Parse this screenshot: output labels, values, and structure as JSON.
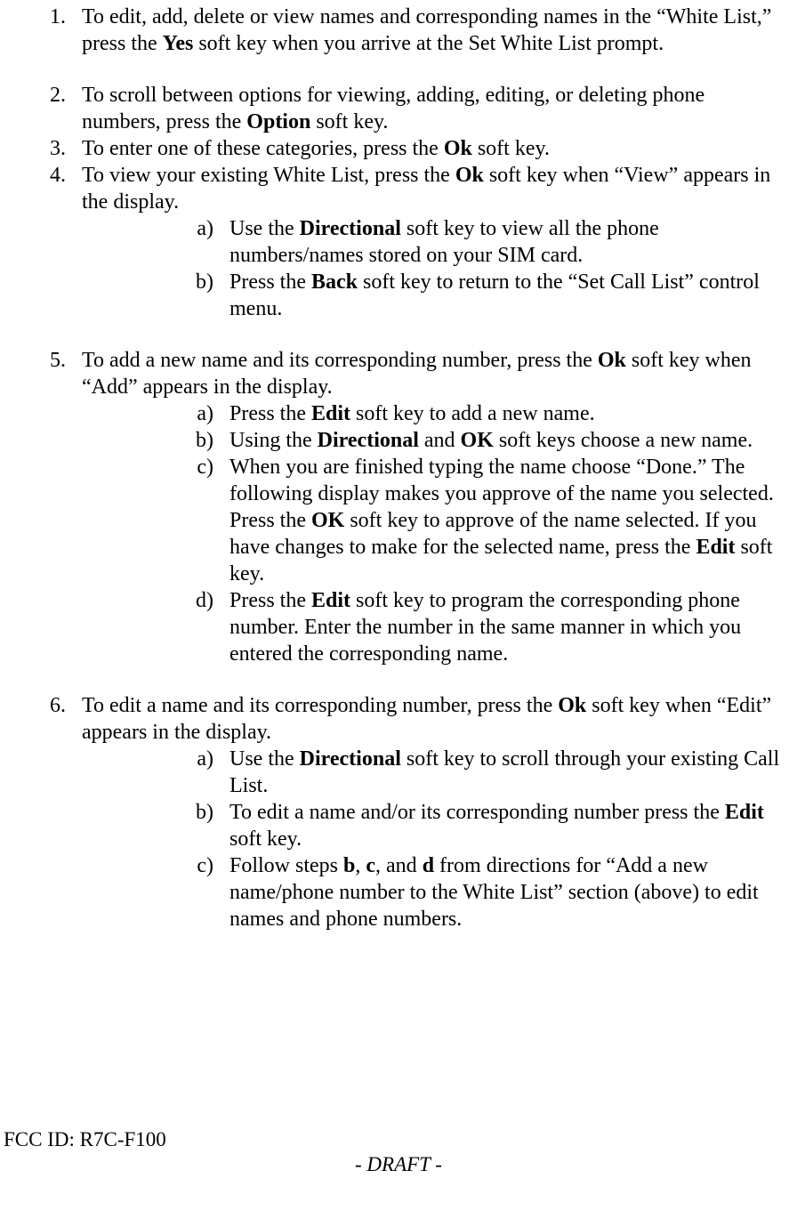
{
  "items": [
    {
      "segments": [
        {
          "t": "To edit, add, delete or view names and corresponding names in the “White List,” press the "
        },
        {
          "t": "Yes",
          "b": true
        },
        {
          "t": " soft key when you arrive at the Set White List prompt."
        }
      ],
      "gap": true
    },
    {
      "segments": [
        {
          "t": "To scroll between options for viewing, adding, editing, or deleting phone numbers, press the "
        },
        {
          "t": "Option",
          "b": true
        },
        {
          "t": " soft key."
        }
      ]
    },
    {
      "segments": [
        {
          "t": "To enter one of these categories, press the "
        },
        {
          "t": "Ok",
          "b": true
        },
        {
          "t": " soft key."
        }
      ]
    },
    {
      "segments": [
        {
          "t": "To view your existing White List, press the "
        },
        {
          "t": "Ok",
          "b": true
        },
        {
          "t": " soft key when “View” appears in the display."
        }
      ],
      "sub": [
        [
          {
            "t": "Use the "
          },
          {
            "t": "Directional",
            "b": true
          },
          {
            "t": " soft key to view all the phone numbers/names stored on your SIM card."
          }
        ],
        [
          {
            "t": "Press the "
          },
          {
            "t": "Back",
            "b": true
          },
          {
            "t": " soft key to return to the “Set Call List” control menu."
          }
        ]
      ],
      "gap": true
    },
    {
      "segments": [
        {
          "t": "To add a new name and its corresponding number, press the "
        },
        {
          "t": "Ok",
          "b": true
        },
        {
          "t": " soft key when “Add” appears in the display."
        }
      ],
      "sub": [
        [
          {
            "t": "Press the "
          },
          {
            "t": "Edit",
            "b": true
          },
          {
            "t": " soft key to add a new name."
          }
        ],
        [
          {
            "t": "Using the "
          },
          {
            "t": "Directional",
            "b": true
          },
          {
            "t": " and "
          },
          {
            "t": "OK",
            "b": true
          },
          {
            "t": " soft keys choose a new name."
          }
        ],
        [
          {
            "t": "When you are finished typing the name choose “Done.”  The following display makes you approve of the name you selected.  Press the "
          },
          {
            "t": "OK",
            "b": true
          },
          {
            "t": " soft key to approve of the name selected.  If you have changes to make for the selected name, press the "
          },
          {
            "t": "Edit",
            "b": true
          },
          {
            "t": " soft key."
          }
        ],
        [
          {
            "t": "Press the "
          },
          {
            "t": "Edit",
            "b": true
          },
          {
            "t": " soft key to program the corresponding phone number.  Enter the number in the same manner in which you entered the corresponding name."
          }
        ]
      ],
      "gap": true
    },
    {
      "segments": [
        {
          "t": "To edit a name and its corresponding number, press the "
        },
        {
          "t": "Ok",
          "b": true
        },
        {
          "t": " soft key when “Edit” appears in the display."
        }
      ],
      "sub": [
        [
          {
            "t": "Use the "
          },
          {
            "t": "Directional",
            "b": true
          },
          {
            "t": " soft key to scroll through your existing Call List."
          }
        ],
        [
          {
            "t": "To edit a name and/or its corresponding number press the "
          },
          {
            "t": "Edit",
            "b": true
          },
          {
            "t": " soft key."
          }
        ],
        [
          {
            "t": "Follow steps "
          },
          {
            "t": "b",
            "b": true
          },
          {
            "t": ", "
          },
          {
            "t": "c",
            "b": true
          },
          {
            "t": ", and "
          },
          {
            "t": "d",
            "b": true
          },
          {
            "t": " from directions for “Add a new name/phone number to the White List” section (above) to edit names and phone numbers."
          }
        ]
      ]
    }
  ],
  "footer": {
    "fcc_id": "FCC ID: R7C-F100",
    "draft": "- DRAFT -"
  }
}
